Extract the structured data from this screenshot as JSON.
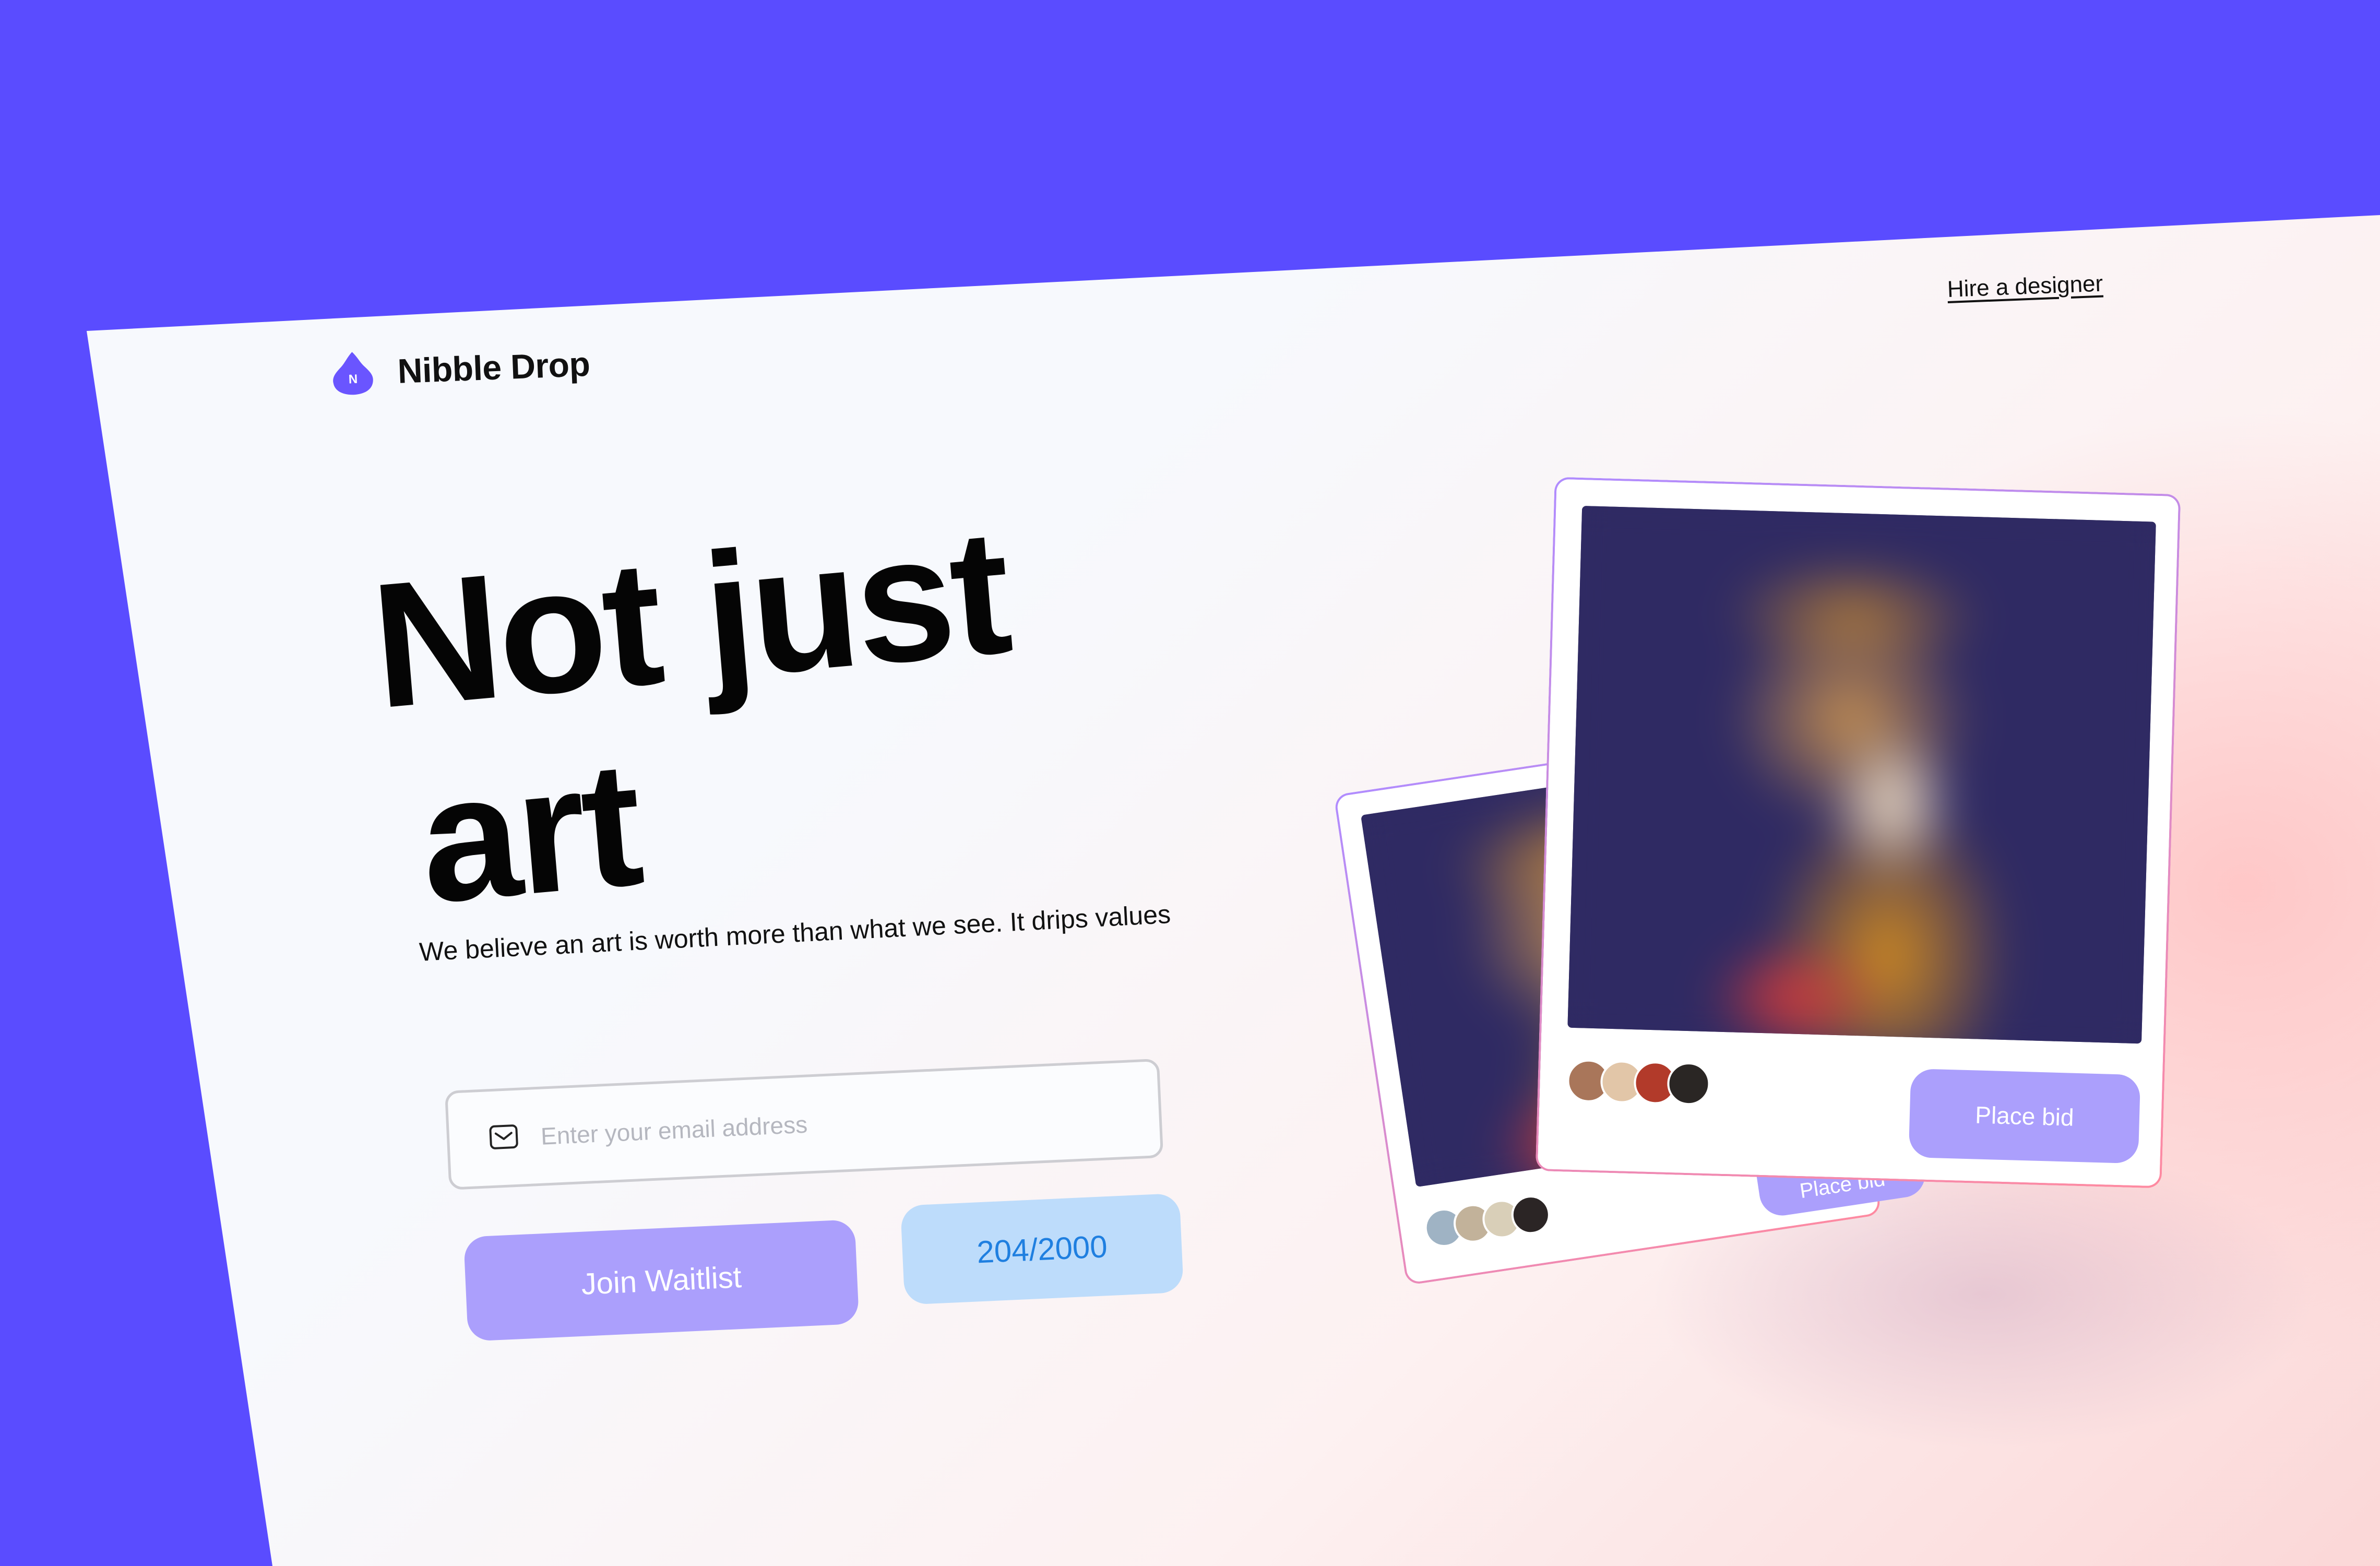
{
  "header": {
    "brand_initial": "N",
    "brand_name": "Nibble Drop",
    "hire_link": "Hire a designer"
  },
  "hero": {
    "line1": "Not just",
    "line2": "art",
    "subtitle": "We believe an art is worth more than what we see. It drips values"
  },
  "waitlist": {
    "email_placeholder": "Enter your email address",
    "email_value": "",
    "join_label": "Join Waitlist",
    "counter": "204/2000"
  },
  "cards": [
    {
      "bid_label": "Place bid",
      "avatars": [
        "#c9a27e",
        "#8f6f5a",
        "#d9c8b0",
        "#3a2a26"
      ]
    },
    {
      "bid_label": "Place bid",
      "avatars": [
        "#a9765a",
        "#e2c6a8",
        "#b23a2a",
        "#2a2624"
      ]
    }
  ],
  "colors": {
    "frame": "#5a4cff",
    "accent": "#ab9ffc",
    "counter_bg": "#bddcfb",
    "counter_text": "#1f7fe0"
  }
}
